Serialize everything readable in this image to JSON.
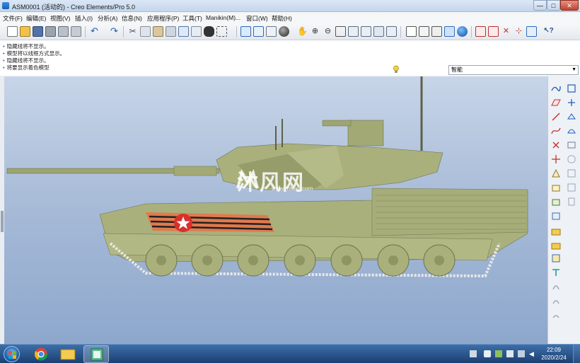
{
  "window": {
    "title": "ASM0001 (活动的) - Creo Elements/Pro 5.0",
    "min_label": "—",
    "max_label": "□",
    "close_label": "✕"
  },
  "menu": [
    "文件(F)",
    "编辑(E)",
    "视图(V)",
    "插入(I)",
    "分析(A)",
    "信息(N)",
    "应用程序(P)",
    "工具(T)",
    "Manikin(M)...",
    "窗口(W)",
    "帮助(H)"
  ],
  "messages": [
    "隐藏线将不显示。",
    "模型将以线框方式显示。",
    "隐藏线将不显示。",
    "将要显示着色模型"
  ],
  "filter": {
    "selected": "智能"
  },
  "watermark": {
    "text": "沐风网",
    "sub": "www.mfcad.com"
  },
  "taskbar": {
    "time": "22:09",
    "date": "2020/2/24"
  },
  "colors": {
    "tank_body": "#a9b07c",
    "tank_dark": "#8e9562",
    "viewport_top": "#c7d5e8",
    "viewport_bottom": "#8da7cc",
    "stripe_orange": "#e07a4f",
    "stripe_black": "#222222",
    "star_red": "#d9302a"
  }
}
